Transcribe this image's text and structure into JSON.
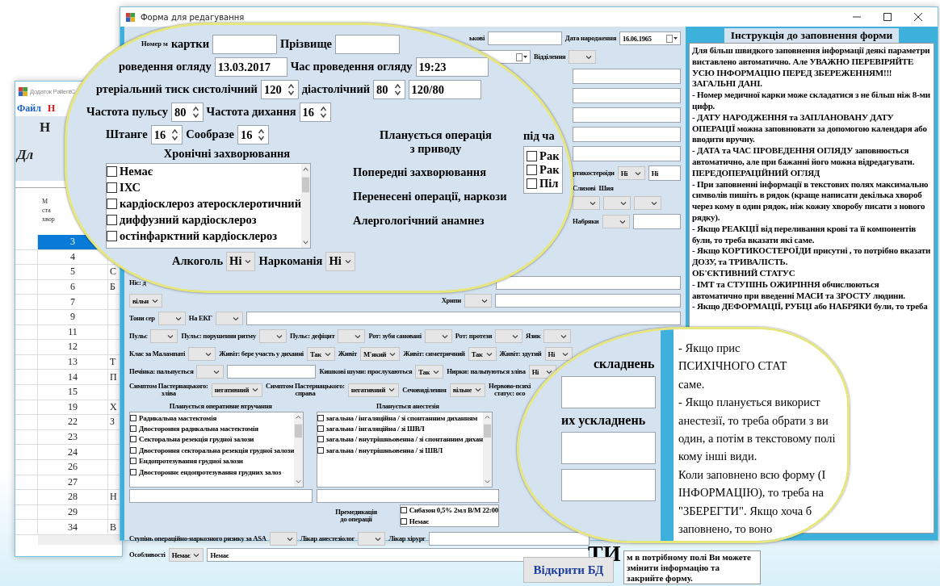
{
  "back_window": {
    "title": "Додаток PatientC",
    "menu": [
      {
        "label": "Файл",
        "color": "#1a5fc8"
      },
      {
        "label": "Н",
        "color": "#e01010"
      }
    ],
    "heading": "Н",
    "subheading": "Дл",
    "table": {
      "column_1_header": [
        "М",
        "ста",
        "хвор"
      ],
      "rows": [
        {
          "number": "3",
          "selected": true
        },
        {
          "number": "4",
          "selected": false
        },
        {
          "number": "5",
          "column_2": "С",
          "selected": false
        },
        {
          "number": "6",
          "column_2": "Б",
          "selected": false
        },
        {
          "number": "7",
          "selected": false
        },
        {
          "number": "9",
          "selected": false
        },
        {
          "number": "11",
          "selected": false
        },
        {
          "number": "12",
          "selected": false
        },
        {
          "number": "13",
          "column_2": "Т",
          "selected": false
        },
        {
          "number": "14",
          "column_2": "П",
          "selected": false
        },
        {
          "number": "15",
          "selected": false
        },
        {
          "number": "19",
          "column_2": "Х",
          "selected": false
        },
        {
          "number": "22",
          "column_2": "З",
          "selected": false
        },
        {
          "number": "23",
          "selected": false
        },
        {
          "number": "24",
          "selected": false
        },
        {
          "number": "26",
          "selected": false
        },
        {
          "number": "27",
          "selected": false
        },
        {
          "number": "28",
          "column_2": "Н",
          "selected": false
        },
        {
          "number": "29",
          "selected": false
        },
        {
          "number": "34",
          "column_2": "В",
          "selected": false
        }
      ]
    }
  },
  "form_window": {
    "title": "Форма для редагування",
    "top_rows": [
      {
        "fields": [
          {
            "kind": "label",
            "text": "ькові"
          },
          {
            "kind": "input"
          },
          {
            "kind": "label",
            "text": "Дата народження"
          },
          {
            "kind": "date",
            "value": "16.06.1965"
          }
        ]
      },
      {
        "fields": [
          {
            "kind": "date"
          },
          {
            "kind": "label",
            "text": "Відділення"
          },
          {
            "kind": "combo"
          }
        ]
      }
    ],
    "side_rows": [
      {
        "fields": [
          {
            "kind": "area"
          }
        ]
      },
      {
        "fields": [
          {
            "kind": "area"
          }
        ]
      },
      {
        "fields": [
          {
            "kind": "area"
          }
        ]
      },
      {
        "fields": [
          {
            "kind": "area"
          }
        ]
      },
      {
        "fields": [
          {
            "kind": "area"
          }
        ]
      },
      {
        "fields": [
          {
            "kind": "label",
            "text": "ртикостероїди"
          },
          {
            "kind": "combo",
            "value": "Ні"
          },
          {
            "kind": "area",
            "value": "Ні"
          }
        ]
      },
      {
        "fields": [
          {
            "kind": "label",
            "text": "Слизові"
          },
          {
            "kind": "label",
            "text": "Шия"
          }
        ]
      },
      {
        "fields": [
          {
            "kind": "combo"
          },
          {
            "kind": "combo"
          },
          {
            "kind": "combo"
          }
        ]
      },
      {
        "fields": [
          {
            "kind": "label",
            "text": "Набряки"
          },
          {
            "kind": "combo"
          },
          {
            "kind": "area"
          }
        ]
      }
    ],
    "mid_rows": [
      {
        "fields": [
          {
            "kind": "label",
            "text": "Ніс: д"
          },
          {
            "kind": "input"
          }
        ]
      },
      {
        "fields": [
          {
            "kind": "combo",
            "value": "вільн"
          },
          {
            "kind": "label",
            "text": "Хрипи"
          },
          {
            "kind": "combo"
          },
          {
            "kind": "input"
          }
        ]
      },
      {
        "fields": [
          {
            "kind": "label",
            "text": "Тони сер"
          },
          {
            "kind": "combo"
          },
          {
            "kind": "label",
            "text": "На ЕКГ"
          },
          {
            "kind": "combo"
          },
          {
            "kind": "input"
          }
        ]
      },
      {
        "fields": [
          {
            "kind": "label",
            "text": "Пульс"
          },
          {
            "kind": "combo"
          },
          {
            "kind": "label",
            "text": "Пульс: порушення ритму"
          },
          {
            "kind": "combo"
          },
          {
            "kind": "label",
            "text": "Пульс: дефіцит"
          },
          {
            "kind": "combo"
          },
          {
            "kind": "label",
            "text": "Рот: зуби сановані"
          },
          {
            "kind": "combo"
          },
          {
            "kind": "label",
            "text": "Рот: протези"
          },
          {
            "kind": "combo"
          },
          {
            "kind": "label",
            "text": "Язик"
          },
          {
            "kind": "combo"
          }
        ]
      },
      {
        "fields": [
          {
            "kind": "label",
            "text": "Клас за Малампаті"
          },
          {
            "kind": "combo"
          },
          {
            "kind": "label",
            "text": "Живіт: бере участь у диханні"
          },
          {
            "kind": "combo",
            "value": "Так"
          },
          {
            "kind": "label",
            "text": "Живіт"
          },
          {
            "kind": "combo",
            "value": "М'який"
          },
          {
            "kind": "label",
            "text": "Живіт: симетричний"
          },
          {
            "kind": "combo",
            "value": "Так"
          },
          {
            "kind": "label",
            "text": "Живіт: здутий"
          },
          {
            "kind": "combo",
            "value": "Ні"
          }
        ]
      },
      {
        "fields": [
          {
            "kind": "label",
            "text": "Печінка: пальпується"
          },
          {
            "kind": "combo"
          },
          {
            "kind": "input"
          },
          {
            "kind": "label",
            "text": "Кишкові шуми: прослухаються"
          },
          {
            "kind": "combo",
            "value": "Так"
          },
          {
            "kind": "label",
            "text": "Нирки: пальпуються зліва"
          },
          {
            "kind": "combo",
            "value": "Ні"
          }
        ]
      },
      {
        "fields": [
          {
            "kind": "label",
            "text": "Симптом Пастернацького:\nзліва"
          },
          {
            "kind": "combo",
            "value": "негативний"
          },
          {
            "kind": "label",
            "text": "Симптом Пастернацького:\nсправа"
          },
          {
            "kind": "combo",
            "value": "негативний"
          },
          {
            "kind": "label",
            "text": "Сечовиділення"
          },
          {
            "kind": "combo",
            "value": "вільне"
          },
          {
            "kind": "label",
            "text": "Нервово-психі\nстатус: осо"
          }
        ]
      }
    ],
    "plan_columns": [
      {
        "rows": [
          {
            "fields": [
              {
                "kind": "heading",
                "text": "Планується оперативне втручання"
              }
            ]
          },
          {
            "fields": [
              {
                "kind": "checklist",
                "scrollable": true,
                "items": [
                  {
                    "label": "Радикальна мастектомія",
                    "checked": false
                  },
                  {
                    "label": "Двостороння радикальна мастектомія",
                    "checked": false
                  },
                  {
                    "label": "Секторальна резекція грудної залози",
                    "checked": false
                  },
                  {
                    "label": "Двостороння секторальна резекція грудної залози",
                    "checked": false
                  },
                  {
                    "label": "Ендопротезування грудної залози",
                    "checked": false
                  },
                  {
                    "label": "Двостороннє ендопротезування грудних залоз",
                    "checked": false
                  }
                ]
              }
            ]
          },
          {
            "fields": [
              {
                "kind": "input"
              }
            ]
          }
        ]
      },
      {
        "rows": [
          {
            "fields": [
              {
                "kind": "heading",
                "text": "Планується анестезія"
              }
            ]
          },
          {
            "fields": [
              {
                "kind": "checklist",
                "scrollable": true,
                "items": [
                  {
                    "label": "загальна / інгаляційна / зі спонтанним диханням",
                    "checked": false
                  },
                  {
                    "label": "загальна / інгаляційна / зі ШВЛ",
                    "checked": false
                  },
                  {
                    "label": "загальна / внутрішньовенна / зі спонтанним дихан",
                    "checked": false
                  },
                  {
                    "label": "загальна / внутрішньовенна / зі ШВЛ",
                    "checked": false
                  }
                ]
              }
            ]
          },
          {
            "fields": [
              {
                "kind": "input"
              }
            ]
          },
          {
            "fields": [
              {
                "kind": "heading",
                "text": "Премедикація\nдо операції"
              },
              {
                "kind": "checklist",
                "scrollable": false,
                "items": [
                  {
                    "label": "Сибазон 0,5% 2мл В/М 22:00",
                    "checked": false
                  },
                  {
                    "label": "Немає",
                    "checked": false
                  }
                ]
              }
            ]
          }
        ]
      }
    ],
    "bottom_rows": [
      {
        "fields": [
          {
            "kind": "label",
            "text": "Ступінь операційно-наркозного ризику за ASA"
          },
          {
            "kind": "combo"
          },
          {
            "kind": "label",
            "text": "Лікар анестезіолог"
          },
          {
            "kind": "combo"
          },
          {
            "kind": "label",
            "text": "Лікар хірург"
          },
          {
            "kind": "input"
          }
        ]
      },
      {
        "fields": [
          {
            "kind": "label",
            "text": "Особливості"
          },
          {
            "kind": "combo",
            "value": "Немає"
          },
          {
            "kind": "input",
            "value": "Немає"
          }
        ]
      }
    ],
    "instructions": {
      "title": "Інструкція до заповнення форми",
      "paragraphs": [
        "Для більш швидкого заповнення інформації деякі параметри виставлено автоматично. Але УВАЖНО ПЕРЕВІРЯЙТЕ УСЮ ІНФОРМАЦІЮ ПЕРЕД ЗБЕРЕЖЕННЯМ!!!",
        "ЗАГАЛЬНІ ДАНІ.",
        "- Номер медичної карки може складатися з не більш ніж 8-ми цифр.",
        "- ДАТУ НАРОДЖЕННЯ та ЗАПЛАНОВАНУ ДАТУ ОПЕРАЦІЇ можна заповнювати за допомогою календаря або вводити вручну.",
        "- ДАТА та ЧАС ПРОВЕДЕННЯ ОГЛЯДУ заповнюється автоматично, але при бажанні його можна відредагувати.",
        "ПЕРЕДОПЕРАЦІЙНИЙ ОГЛЯД",
        "- При заповненні інформації в текстових полях максимально символів пишіть в рядок (краще написати декілька хвороб через кому в один рядок, ніж кожну хворобу писати з нового рядку).",
        "- Якщо РЕАКЦІЇ від переливання крові та її компонентів були, то треба вказати які саме.",
        "- Якщо КОРТИКОСТЕРОЇДИ присутні , то потрібно вказати ДОЗУ, та ТРИВАЛІСТЬ.",
        "ОБ'ЄКТИВНИЙ СТАТУС",
        "- ІМТ та СТУПІНЬ ОЖИРІННЯ обчислюються автоматично при введенні МАСИ та ЗРОСТУ людини.",
        "- Якщо ДЕФОРМАЦІЇ, РУБЦІ або НАБРЯКИ були, то треба"
      ]
    }
  },
  "magnifier_top": {
    "rows": [
      {
        "fields": [
          {
            "kind": "tiny",
            "text": "Номер м"
          },
          {
            "kind": "label",
            "text": "картки"
          },
          {
            "kind": "input"
          },
          {
            "kind": "label",
            "text": "Прізвище"
          },
          {
            "kind": "input"
          }
        ]
      },
      {
        "fields": [
          {
            "kind": "label",
            "text": "роведення огляду"
          },
          {
            "kind": "input",
            "value": "13.03.2017"
          },
          {
            "kind": "label",
            "text": "Час проведення огляду"
          },
          {
            "kind": "input",
            "value": "19:23"
          }
        ]
      },
      {
        "fields": [
          {
            "kind": "label",
            "text": "ртеріальний тиск систолічний"
          },
          {
            "kind": "spin",
            "value": "120"
          },
          {
            "kind": "label",
            "text": "діастолічний"
          },
          {
            "kind": "spin",
            "value": "80"
          },
          {
            "kind": "input",
            "value": "120/80"
          }
        ]
      },
      {
        "fields": [
          {
            "kind": "label",
            "text": "Частота пульсу"
          },
          {
            "kind": "spin",
            "value": "80"
          },
          {
            "kind": "label",
            "text": "Частота дихання"
          },
          {
            "kind": "spin",
            "value": "16"
          }
        ]
      }
    ],
    "left_rows": [
      {
        "fields": [
          {
            "kind": "label",
            "text": "Штанге"
          },
          {
            "kind": "spin",
            "value": "16"
          },
          {
            "kind": "label",
            "text": "Сообразе"
          },
          {
            "kind": "spin",
            "value": "16"
          }
        ]
      },
      {
        "fields": [
          {
            "kind": "heading",
            "text": "Хронічні захворювання"
          }
        ]
      },
      {
        "fields": [
          {
            "kind": "checklist",
            "scrollable": true,
            "items": [
              {
                "label": "Немає",
                "checked": false
              },
              {
                "label": "ІХС",
                "checked": false
              },
              {
                "label": "кардіосклероз атеросклеротичний",
                "checked": false
              },
              {
                "label": "диффузний кардіосклероз",
                "checked": false
              },
              {
                "label": "остінфарктний кардіосклероз",
                "checked": false
              }
            ]
          }
        ]
      }
    ],
    "right_rows": [
      {
        "fields": [
          {
            "kind": "heading",
            "text": "Планується операція\nз приводу"
          }
        ]
      },
      {
        "fields": [
          {
            "kind": "label",
            "text": "Попередні захворювання"
          }
        ]
      },
      {
        "fields": [
          {
            "kind": "label",
            "text": "Перенесені операції, наркози"
          }
        ]
      },
      {
        "fields": [
          {
            "kind": "label",
            "text": "Алергологічний анамнез"
          }
        ]
      }
    ],
    "far_rows": [
      {
        "fields": [
          {
            "kind": "label",
            "text": "під ча"
          }
        ]
      },
      {
        "fields": [
          {
            "kind": "checklist",
            "scrollable": false,
            "items": [
              {
                "label": "Рак",
                "checked": false
              },
              {
                "label": "Рак",
                "checked": false
              },
              {
                "label": "Піл",
                "checked": false
              }
            ]
          }
        ]
      }
    ],
    "bottom_rows": [
      {
        "fields": [
          {
            "kind": "label",
            "text": "Алкоголь"
          },
          {
            "kind": "combo",
            "value": "Ні"
          },
          {
            "kind": "label",
            "text": "Наркоманія"
          },
          {
            "kind": "combo",
            "value": "Ні"
          }
        ]
      }
    ]
  },
  "magnifier_bottom": {
    "form_rows": [
      {
        "fields": [
          {
            "kind": "label",
            "text": "складнень"
          }
        ]
      },
      {
        "fields": [
          {
            "kind": "area"
          }
        ]
      },
      {
        "fields": [
          {
            "kind": "label",
            "text": "их ускладнень"
          }
        ]
      },
      {
        "fields": [
          {
            "kind": "area"
          }
        ]
      },
      {
        "fields": [
          {
            "kind": "area"
          }
        ]
      }
    ],
    "text_lines": [
      "- Якщо прис",
      "ПСИХІЧНОГО СТАТ",
      "саме.",
      "- Якщо планується використ",
      "анестезії, то треба обрати з ви",
      "один, а потім в текстовому полі",
      "кому інші види.",
      "Коли заповнено всю форму (І",
      "ІНФОРМАЦІЮ), то треба на",
      "\"ЗБЕРЕГТИ\". Якщо хоча б",
      "заповнено, то воно"
    ]
  },
  "bottom_bar": {
    "open_button": "Відкрити БД",
    "partial_heading": "ТИ",
    "note": "м в потрібному полі Ви можете змінити інформацію та закрийте форму."
  }
}
